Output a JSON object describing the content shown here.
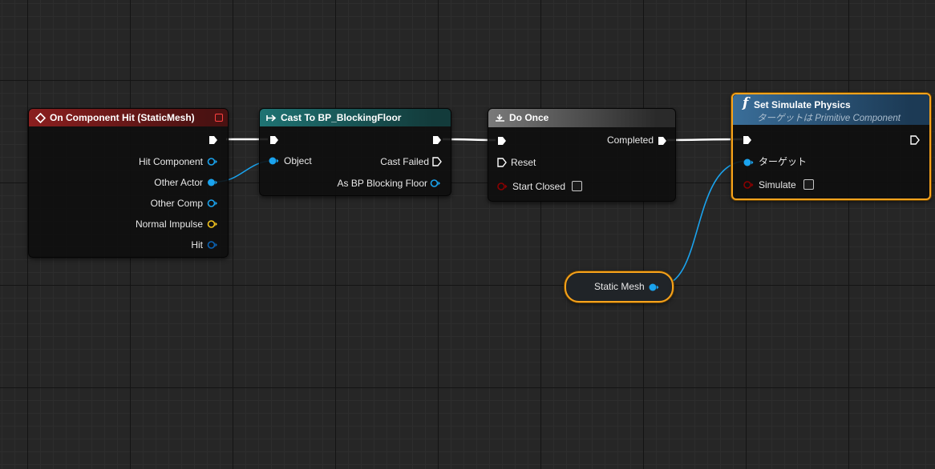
{
  "nodes": {
    "on_component_hit": {
      "title": "On Component Hit (StaticMesh)",
      "header_color": "#7a1d1d",
      "pins": [
        "Hit Component",
        "Other Actor",
        "Other Comp",
        "Normal Impulse",
        "Hit"
      ]
    },
    "cast": {
      "title": "Cast To BP_BlockingFloor",
      "header_color": "#1d6b6b",
      "in_pin": "Object",
      "out_pins": [
        "Cast Failed",
        "As BP Blocking Floor"
      ]
    },
    "do_once": {
      "title": "Do Once",
      "header_color": "#6a6a6a",
      "out_pin": "Completed",
      "in_pins": [
        "Reset",
        "Start Closed"
      ]
    },
    "set_simulate": {
      "title": "Set Simulate Physics",
      "subtitle": "ターゲットは Primitive Component",
      "header_color": "#2f5f86",
      "pins": [
        "ターゲット",
        "Simulate"
      ]
    },
    "static_mesh": {
      "label": "Static Mesh"
    }
  },
  "colors": {
    "object_pin": "#1aa3ee",
    "struct_pin": "#0a63b5",
    "vector_pin": "#f2c31e",
    "bool_pin": "#8c0000",
    "exec_wire": "#ffffff",
    "selection": "#f7a31c"
  }
}
